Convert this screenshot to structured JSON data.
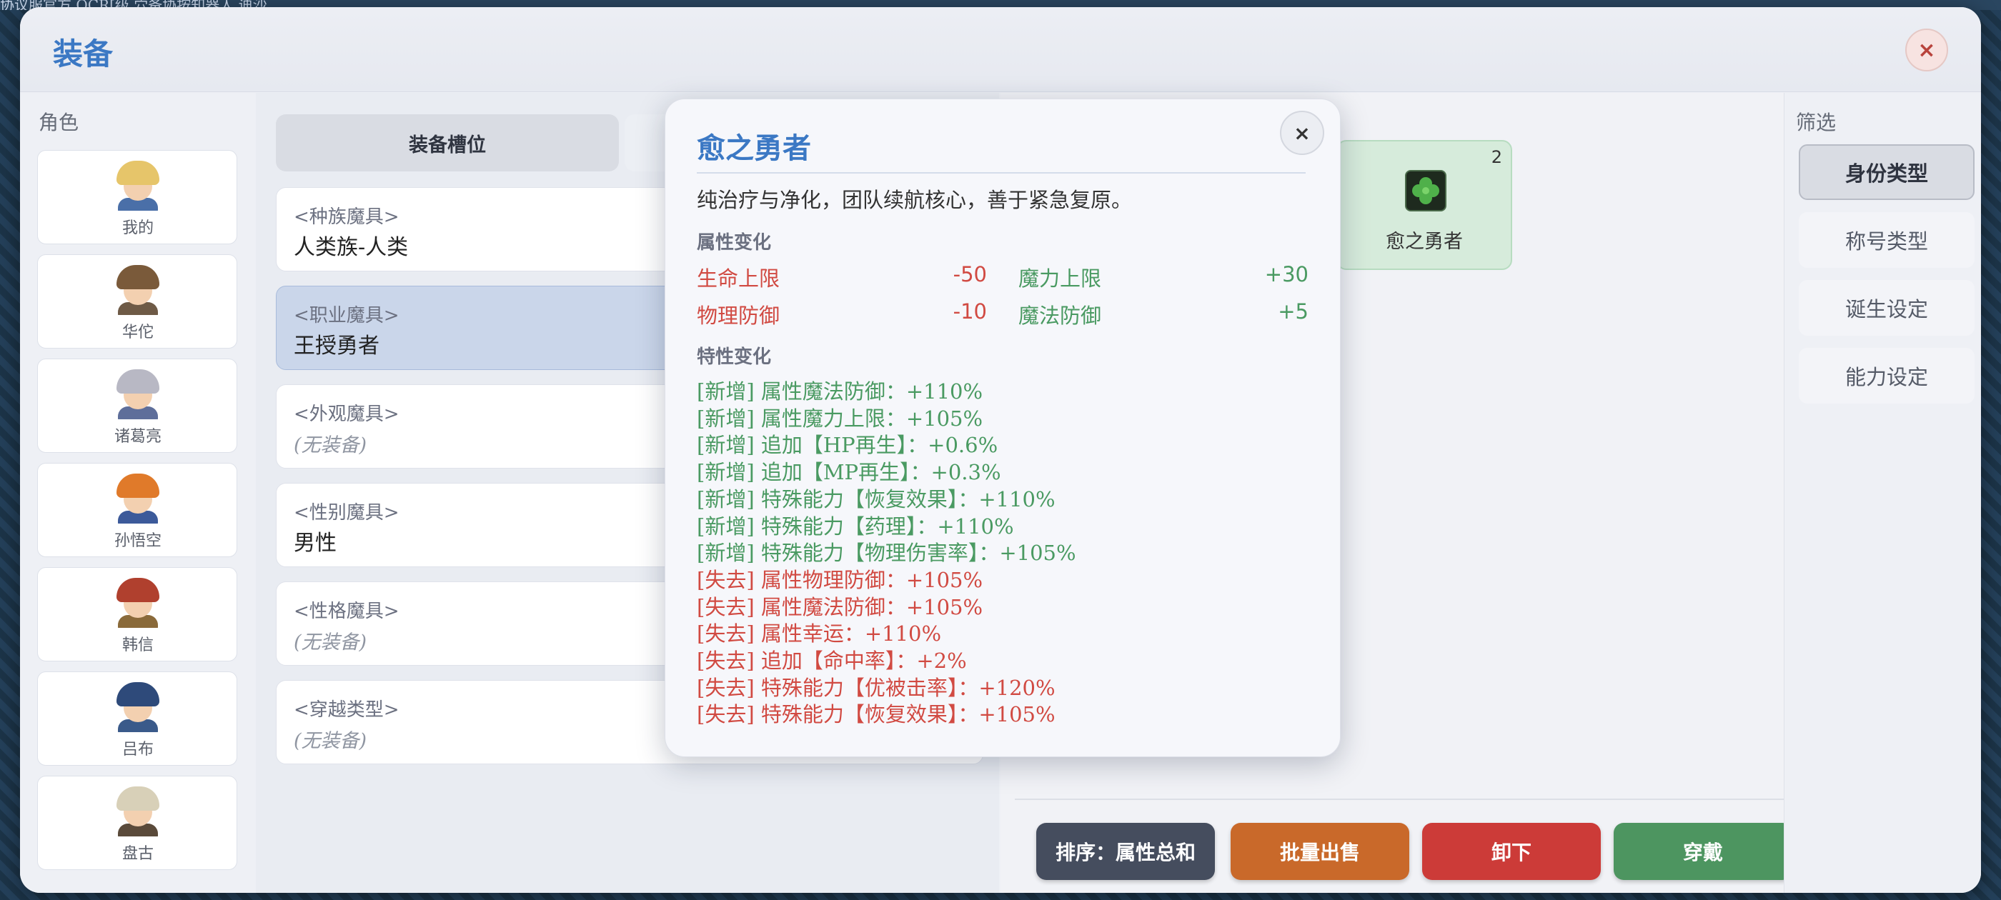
{
  "background_text": "协议服官方 OCR[级 穴备协按知器人 迪沙",
  "window": {
    "title": "装备",
    "close": "×"
  },
  "roles": {
    "label": "角色",
    "items": [
      {
        "name": "我的",
        "hair": "#e6c56a",
        "body": "#4a6fa8"
      },
      {
        "name": "华佗",
        "hair": "#7a5a3a",
        "body": "#6e5a46"
      },
      {
        "name": "诸葛亮",
        "hair": "#b8b8c4",
        "body": "#5e6e9a"
      },
      {
        "name": "孙悟空",
        "hair": "#e07a2a",
        "body": "#3c5a9a"
      },
      {
        "name": "韩信",
        "hair": "#b0402e",
        "body": "#8a6a3a"
      },
      {
        "name": "吕布",
        "hair": "#2e4a7a",
        "body": "#3a5a8a"
      },
      {
        "name": "盘古",
        "hair": "#d8d0b8",
        "body": "#5a4a3a"
      }
    ]
  },
  "slots": {
    "tab_active": "装备槽位",
    "items": [
      {
        "head": "<种族魔具>",
        "value": "人类族-人类",
        "empty": false
      },
      {
        "head": "<职业魔具>",
        "value": "王授勇者",
        "empty": false
      },
      {
        "head": "<外观魔具>",
        "value": "(无装备)",
        "empty": true
      },
      {
        "head": "<性别魔具>",
        "value": "男性",
        "empty": false
      },
      {
        "head": "<性格魔具>",
        "value": "(无装备)",
        "empty": true
      },
      {
        "head": "<穿越类型>",
        "value": "(无装备)",
        "empty": true
      }
    ]
  },
  "item": {
    "name": "愈之勇者",
    "count": "2",
    "icon": "clover-icon"
  },
  "actions": {
    "sort": "排序：属性总和",
    "sell": "批量出售",
    "unequip": "卸下",
    "equip": "穿戴"
  },
  "filter": {
    "label": "筛选",
    "buttons": [
      "身份类型",
      "称号类型",
      "诞生设定",
      "能力设定"
    ]
  },
  "popup": {
    "title": "愈之勇者",
    "close": "×",
    "desc": "纯治疗与净化，团队续航核心，善于紧急复原。",
    "attr_head": "属性变化",
    "stats": [
      {
        "label": "生命上限",
        "value": "-50"
      },
      {
        "label": "魔力上限",
        "value": "+30"
      },
      {
        "label": "物理防御",
        "value": "-10"
      },
      {
        "label": "魔法防御",
        "value": "+5"
      }
    ],
    "trait_head": "特性变化",
    "traits": [
      "[新增] 属性魔法防御：+110%",
      "[新增] 属性魔力上限：+105%",
      "[新增] 追加【HP再生】：+0.6%",
      "[新增] 追加【MP再生】：+0.3%",
      "[新增] 特殊能力【恢复效果】：+110%",
      "[新增] 特殊能力【药理】：+110%",
      "[新增] 特殊能力【物理伤害率】：+105%",
      "[失去] 属性物理防御：+105%",
      "[失去] 属性魔法防御：+105%",
      "[失去] 属性幸运：+110%",
      "[失去] 追加【命中率】：+2%",
      "[失去] 特殊能力【优被击率】：+120%",
      "[失去] 特殊能力【恢复效果】：+105%"
    ]
  },
  "colors": {
    "accent": "#3b78c4",
    "loss": "#d14a42",
    "gain": "#4a9a62"
  }
}
